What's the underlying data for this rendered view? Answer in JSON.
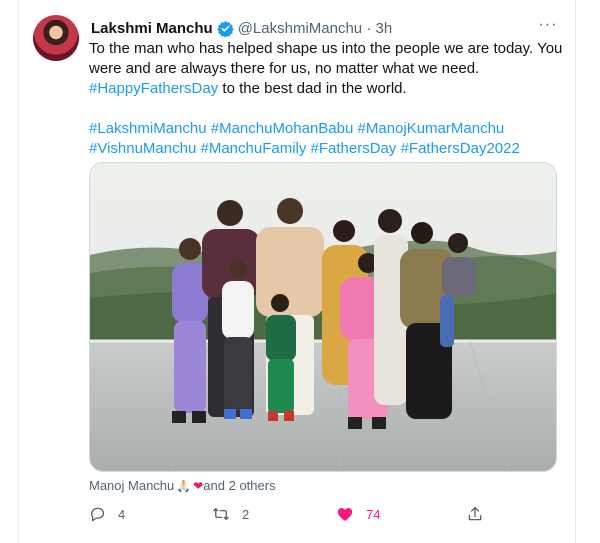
{
  "tweet": {
    "author_name": "Lakshmi Manchu",
    "handle_time": "@LakshmiManchu · 3h",
    "more_label": "···",
    "lines": {
      "l1": "To the man who has helped shape us into the people we are today. You",
      "l2": "were and are always there for us, no matter what we need.",
      "l3_tag": "#HappyFathersDay",
      "l3_rest": " to the best dad in the world.",
      "t1": "#LakshmiManchu",
      "t2": "#ManchuMohanBabu",
      "t3": "#ManojKumarManchu",
      "t4": "#VishnuManchu",
      "t5": "#ManchuFamily",
      "t6": "#FathersDay",
      "t7": "#FathersDay2022"
    },
    "tagged_people": {
      "name": "Manoj Manchu",
      "emoji": "🙏🏻",
      "heart": "❤",
      "others": " and 2 others"
    },
    "actions": {
      "reply_count": "4",
      "retweet_count": "2",
      "like_count": "74"
    }
  },
  "icons": [
    "verified-badge-icon",
    "more-icon",
    "reply-icon",
    "retweet-icon",
    "like-icon",
    "share-icon"
  ],
  "colors": {
    "accent": "#1d9bf0",
    "like": "#f91880",
    "secondary_text": "#536471"
  }
}
